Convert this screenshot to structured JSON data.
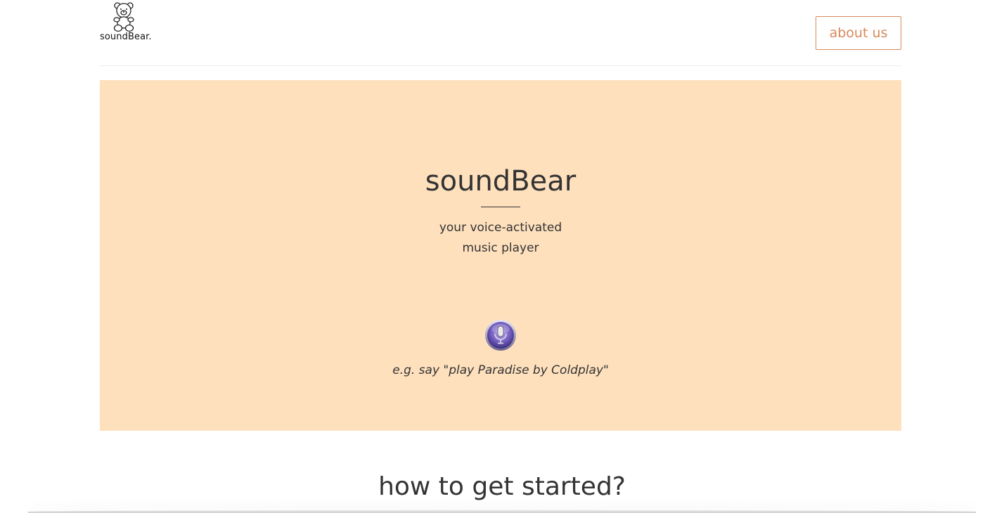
{
  "header": {
    "logo_text": "soundBear.",
    "about_label": "about us"
  },
  "hero": {
    "title": "soundBear",
    "subtitle_line1": "your voice-activated",
    "subtitle_line2": "music player",
    "mic_icon": "microphone-icon",
    "hint": "e.g. say \"play Paradise by Coldplay\""
  },
  "section": {
    "title": "how to get started?"
  },
  "colors": {
    "accent": "#d9885a",
    "hero_bg": "#fee0bd",
    "text": "#333333"
  }
}
